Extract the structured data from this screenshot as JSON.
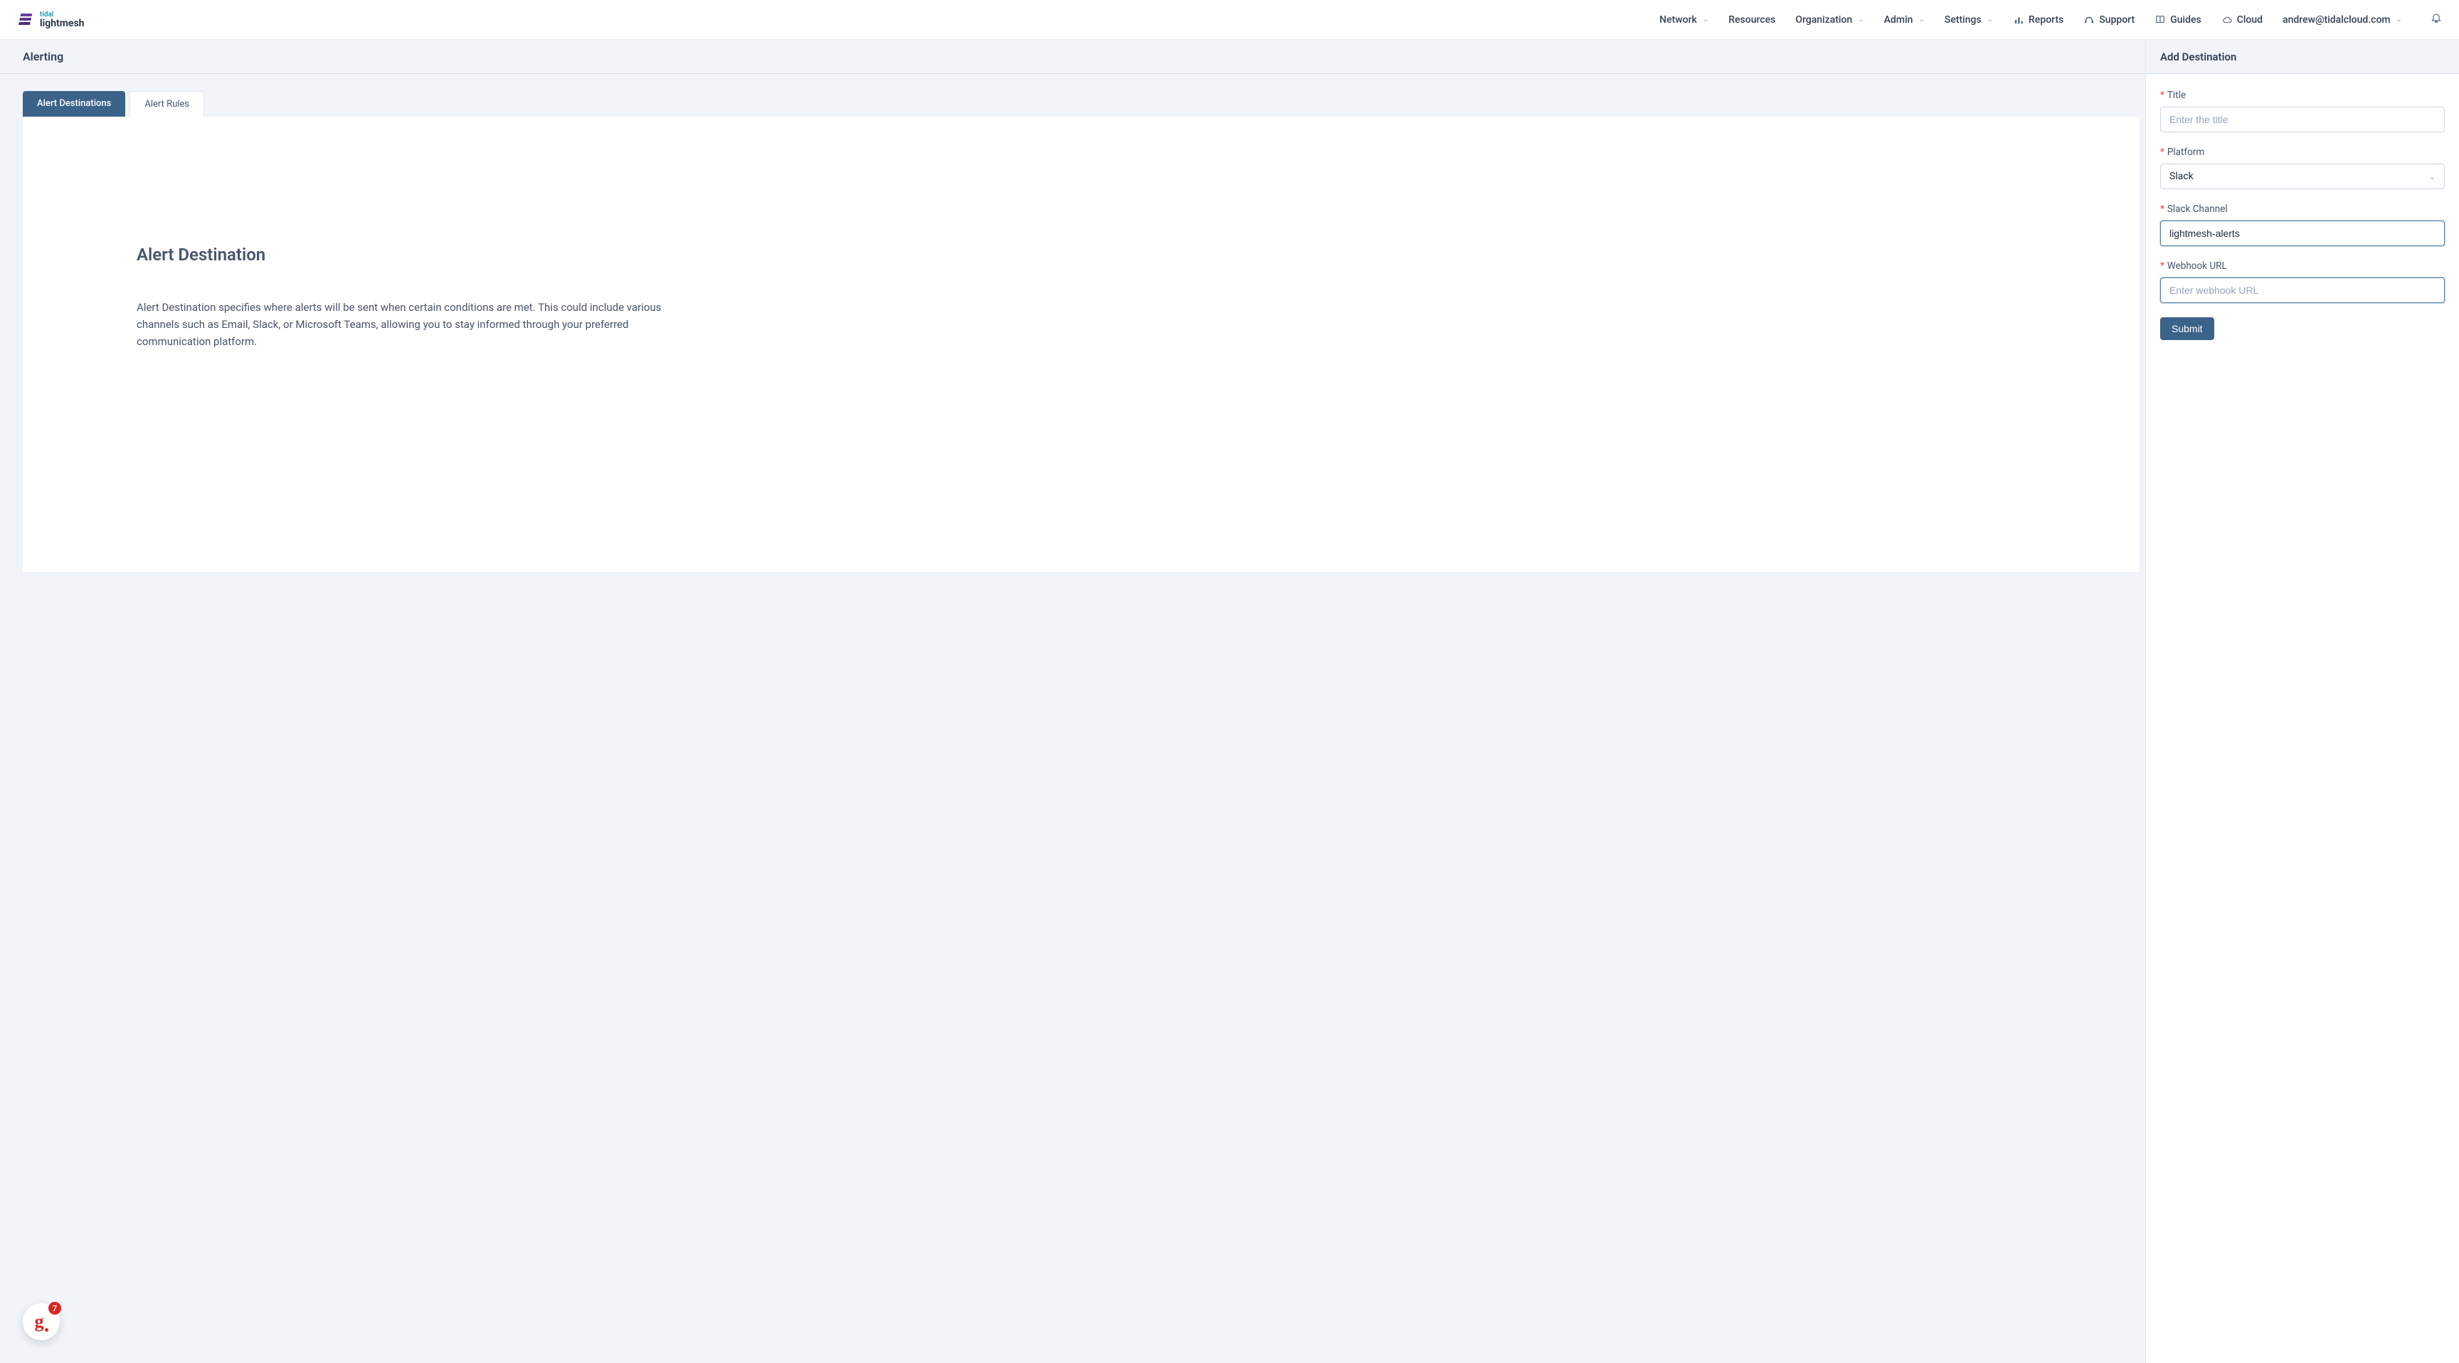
{
  "logo": {
    "tidal": "tidal",
    "lightmesh": "lightmesh"
  },
  "nav": {
    "network": "Network",
    "resources": "Resources",
    "organization": "Organization",
    "admin": "Admin",
    "settings": "Settings",
    "reports": "Reports",
    "support": "Support",
    "guides": "Guides",
    "cloud": "Cloud",
    "user": "andrew@tidalcloud.com"
  },
  "page": {
    "title": "Alerting"
  },
  "tabs": {
    "destinations": "Alert Destinations",
    "rules": "Alert Rules"
  },
  "content": {
    "heading": "Alert Destination",
    "body": "Alert Destination specifies where alerts will be sent when certain conditions are met. This could include various channels such as Email, Slack, or Microsoft Teams, allowing you to stay informed through your preferred communication platform."
  },
  "sidebar": {
    "title": "Add Destination",
    "fields": {
      "title": {
        "label": "Title",
        "placeholder": "Enter the title",
        "value": ""
      },
      "platform": {
        "label": "Platform",
        "value": "Slack"
      },
      "channel": {
        "label": "Slack Channel",
        "value": "lightmesh-alerts"
      },
      "webhook": {
        "label": "Webhook URL",
        "placeholder": "Enter webhook URL",
        "value": ""
      }
    },
    "submit": "Submit"
  },
  "fab": {
    "badge": "7"
  }
}
